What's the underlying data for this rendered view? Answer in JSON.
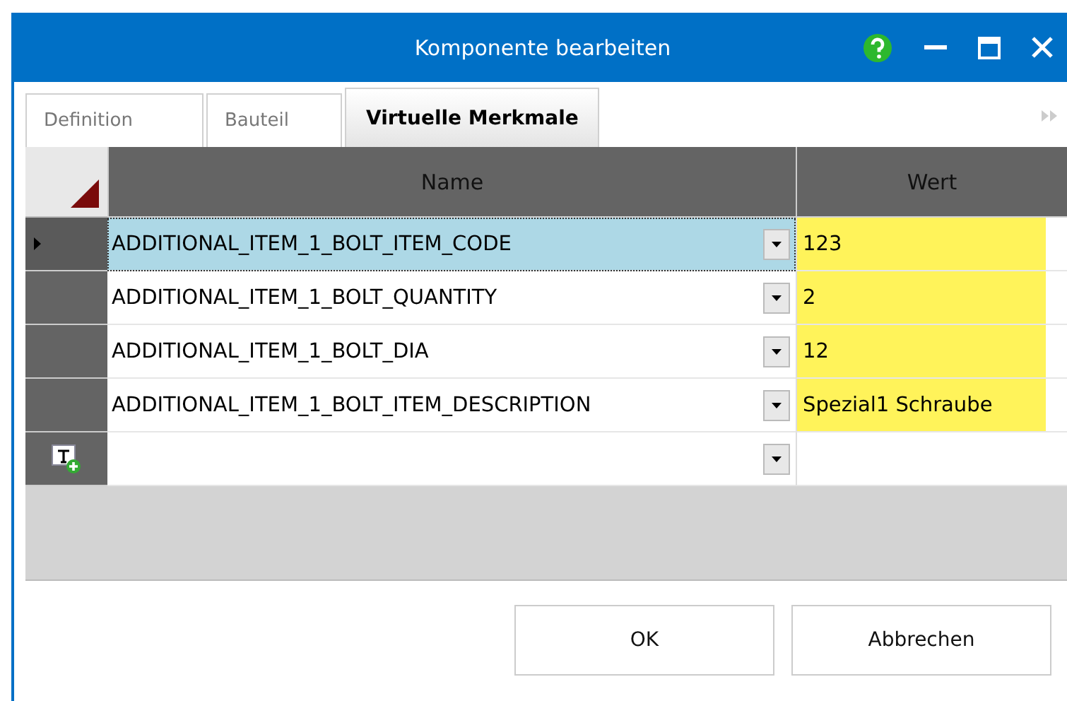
{
  "window": {
    "title": "Komponente bearbeiten"
  },
  "tabs": [
    {
      "label": "Definition",
      "selected": false
    },
    {
      "label": "Bauteil",
      "selected": false
    },
    {
      "label": "Virtuelle Merkmale",
      "selected": true
    }
  ],
  "table": {
    "columns": [
      "Name",
      "Wert"
    ],
    "rows": [
      {
        "name": "ADDITIONAL_ITEM_1_BOLT_ITEM_CODE",
        "value": "123",
        "selected": true,
        "highlighted": true
      },
      {
        "name": "ADDITIONAL_ITEM_1_BOLT_QUANTITY",
        "value": "2",
        "selected": false,
        "highlighted": true
      },
      {
        "name": "ADDITIONAL_ITEM_1_BOLT_DIA",
        "value": "12",
        "selected": false,
        "highlighted": true
      },
      {
        "name": "ADDITIONAL_ITEM_1_BOLT_ITEM_DESCRIPTION",
        "value": "Spezial1 Schraube",
        "selected": false,
        "highlighted": true
      }
    ]
  },
  "buttons": [
    "OK",
    "Abbrechen"
  ]
}
